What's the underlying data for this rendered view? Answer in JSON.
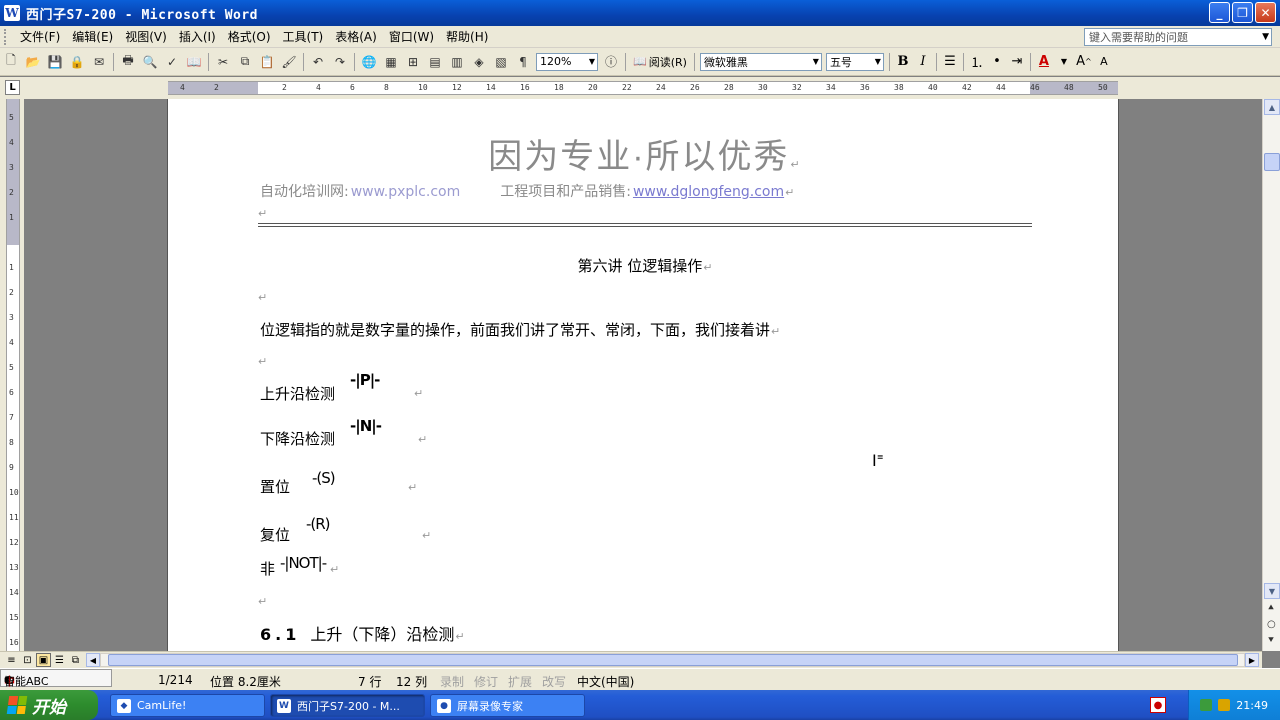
{
  "window": {
    "title": "西门子S7-200 - Microsoft Word",
    "app_icon_letter": "W"
  },
  "menu": {
    "items": [
      "文件(F)",
      "编辑(E)",
      "视图(V)",
      "插入(I)",
      "格式(O)",
      "工具(T)",
      "表格(A)",
      "窗口(W)",
      "帮助(H)"
    ],
    "help_placeholder": "键入需要帮助的问题"
  },
  "toolbar": {
    "zoom": "120%",
    "read_label": "阅读(R)",
    "font_name": "微软雅黑",
    "font_size": "五号",
    "bold": "B",
    "italic": "I"
  },
  "ruler": {
    "numbers": [
      "4",
      "2",
      "",
      "2",
      "4",
      "6",
      "8",
      "10",
      "12",
      "14",
      "16",
      "18",
      "20",
      "22",
      "24",
      "26",
      "28",
      "30",
      "32",
      "34",
      "36",
      "38",
      "40",
      "42",
      "44",
      "46",
      "48",
      "50"
    ],
    "vnumbers": [
      "5",
      "4",
      "3",
      "2",
      "1",
      "",
      "1",
      "2",
      "3",
      "4",
      "5",
      "6",
      "7",
      "8",
      "9",
      "10",
      "11",
      "12",
      "13",
      "14",
      "15",
      "16"
    ]
  },
  "document": {
    "header_title": "因为专业·所以优秀",
    "header_label1": "自动化培训网:",
    "header_site1": "www.pxplc.com",
    "header_label2": "工程项目和产品销售:",
    "header_site2": "www.dglongfeng.com",
    "para_mark": "↵",
    "lecture_title": "第六讲    位逻辑操作",
    "intro": "位逻辑指的就是数字量的操作，前面我们讲了常开、常闭，下面，我们接着讲",
    "ops": [
      {
        "label": "上升沿检测",
        "symbol": "-|P|-"
      },
      {
        "label": "下降沿检测",
        "symbol": "-|N|-"
      },
      {
        "label": "置位",
        "symbol": "-(S)"
      },
      {
        "label": "复位",
        "symbol": "-(R)"
      },
      {
        "label": "非",
        "symbol": "-|NOT|-"
      }
    ],
    "section_num": "6.1",
    "section_title": "上升（下降）沿检测"
  },
  "statusbar": {
    "page": "1/214",
    "position": "位置 8.2厘米",
    "line": "7 行",
    "col": "12 列",
    "rec": "录制",
    "trk": "修订",
    "ext": "扩展",
    "ovr": "改写",
    "lang": "中文(中国)",
    "ime": "智能ABC"
  },
  "taskbar": {
    "start": "开始",
    "tasks": [
      "CamLife!",
      "西门子S7-200 - M...",
      "屏幕录像专家"
    ],
    "clock": "21:49"
  },
  "colors": {
    "titlebar": "#0a5fd8",
    "link": "#7a7ad0",
    "header_gray": "#8a8a8a"
  }
}
